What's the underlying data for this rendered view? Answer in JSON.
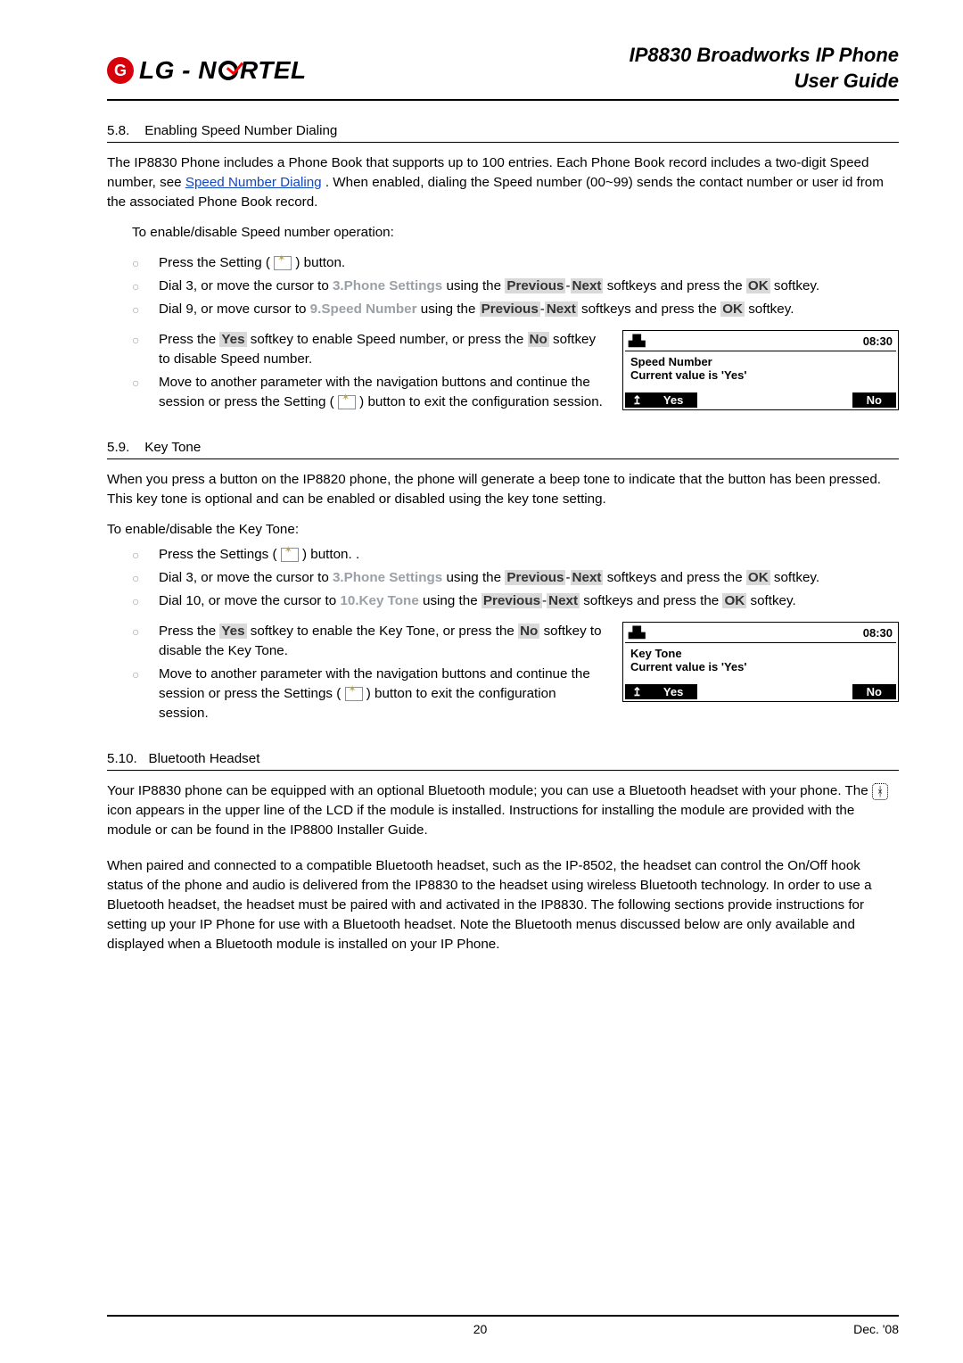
{
  "header": {
    "brand_left": "LG - N",
    "brand_right": "RTEL",
    "title1": "IP8830 Broadworks IP Phone",
    "title2": "User Guide"
  },
  "s58": {
    "num": "5.8.",
    "title": "Enabling Speed Number Dialing",
    "p1a": "The IP8830 Phone includes a Phone Book that supports up to 100 entries.  Each Phone Book record includes a two-digit Speed number, see ",
    "p1_link": "Speed Number Dialing",
    "p1b": ".  When enabled, dialing the Speed number (00~99) sends the contact number or user id from the associated Phone Book record.",
    "lead": "To enable/disable Speed number operation:",
    "li1a": "Press the Setting (",
    "li1b": ") button.",
    "li2a": "Dial 3, or move the cursor to ",
    "li2menu": "3.Phone Settings",
    "li2b": " using the ",
    "li2prev": "Previous",
    "li2dash": "-",
    "li2next": "Next",
    "li2c": " softkeys and press the ",
    "li2ok": "OK",
    "li2d": " softkey.",
    "li3a": "Dial 9, or move cursor to ",
    "li3menu": "9.Speed Number",
    "li3b": " using the ",
    "li3prev": "Previous",
    "li3dash": "-",
    "li3next": "Next",
    "li3c": " softkeys and press the ",
    "li3ok": "OK",
    "li3d": " softkey.",
    "li4a": "Press the ",
    "li4yes": "Yes",
    "li4b": " softkey to enable Speed number, or press the ",
    "li4no": "No",
    "li4c": " softkey to disable Speed number.",
    "li5a": "Move to another parameter with the navigation buttons and continue the session or press the Setting (",
    "li5b": ") button to exit the configuration session."
  },
  "lcd1": {
    "time": "08:30",
    "l1": "Speed Number",
    "l2": "Current value is 'Yes'",
    "sk_up": "↥",
    "sk_yes": "Yes",
    "sk_no": "No"
  },
  "s59": {
    "num": "5.9.",
    "title": "Key Tone",
    "p1": "When you press a button on the IP8820 phone, the phone will generate a beep tone to indicate that the button has been pressed.  This key tone is optional and can be enabled or disabled using the key tone setting.",
    "lead": "To enable/disable the Key Tone:",
    "li1a": "Press the Settings (",
    "li1b": ") button.  .",
    "li2a": "Dial 3, or move the cursor to ",
    "li2menu": "3.Phone Settings",
    "li2b": " using the ",
    "li2prev": "Previous",
    "li2dash": "-",
    "li2next": "Next",
    "li2c": " softkeys and press the ",
    "li2ok": "OK",
    "li2d": " softkey.",
    "li3a": "Dial 10, or move the cursor to ",
    "li3menu": "10.Key Tone",
    "li3b": " using the ",
    "li3prev": "Previous",
    "li3dash": "-",
    "li3next": "Next",
    "li3c": " softkeys and press the ",
    "li3ok": "OK",
    "li3d": " softkey.",
    "li4a": "Press the ",
    "li4yes": "Yes",
    "li4b": " softkey to enable the Key Tone, or press the ",
    "li4no": "No",
    "li4c": " softkey to disable the Key Tone.",
    "li5a": "Move to another parameter with the navigation buttons and continue the session or press the Settings (",
    "li5b": ") button to exit the configuration session."
  },
  "lcd2": {
    "time": "08:30",
    "l1": "Key Tone",
    "l2": "Current value is 'Yes'",
    "sk_up": "↥",
    "sk_yes": "Yes",
    "sk_no": "No"
  },
  "s510": {
    "num": "5.10.",
    "title": "Bluetooth Headset",
    "p1a": "Your IP8830 phone can be equipped with an optional Bluetooth module; you can use a Bluetooth headset with your phone.  The ",
    "icon": "ᚼ",
    "p1b": " icon appears in the upper line of the LCD if the module is installed.  Instructions for installing the module are provided with the module or can be found in the IP8800 Installer Guide.",
    "p2": "When paired and connected to a compatible Bluetooth headset, such as the IP-8502, the headset can control the On/Off hook status of the phone and audio is delivered from the IP8830 to the headset using wireless Bluetooth technology.  In order to use a Bluetooth headset, the headset must be paired with and activated in the IP8830.  The following sections provide instructions for setting up your IP Phone for use with a Bluetooth headset.  Note the Bluetooth menus discussed below are only available and displayed when a Bluetooth module is installed on your IP Phone."
  },
  "footer": {
    "page": "20",
    "date": "Dec. '08"
  }
}
